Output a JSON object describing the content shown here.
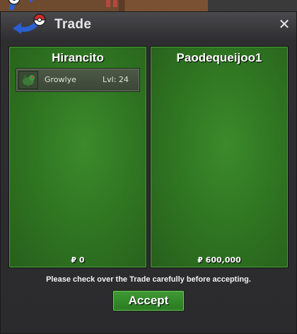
{
  "window": {
    "title": "Trade",
    "close_icon": "close-icon"
  },
  "left": {
    "player": "Hirancito",
    "items": [
      {
        "name": "Growlye",
        "level": "Lvl: 24",
        "icon": "growlithe-sprite-icon"
      }
    ],
    "money": "₽ 0"
  },
  "right": {
    "player": "Paodequeijoo1",
    "items": [],
    "money": "₽ 600,000"
  },
  "footer": {
    "notice": "Please check over the Trade carefully before accepting.",
    "accept_label": "Accept"
  },
  "colors": {
    "panel_green": "#2e7321",
    "accept_green": "#3f9a33",
    "window_dark": "#2b2b2e"
  }
}
